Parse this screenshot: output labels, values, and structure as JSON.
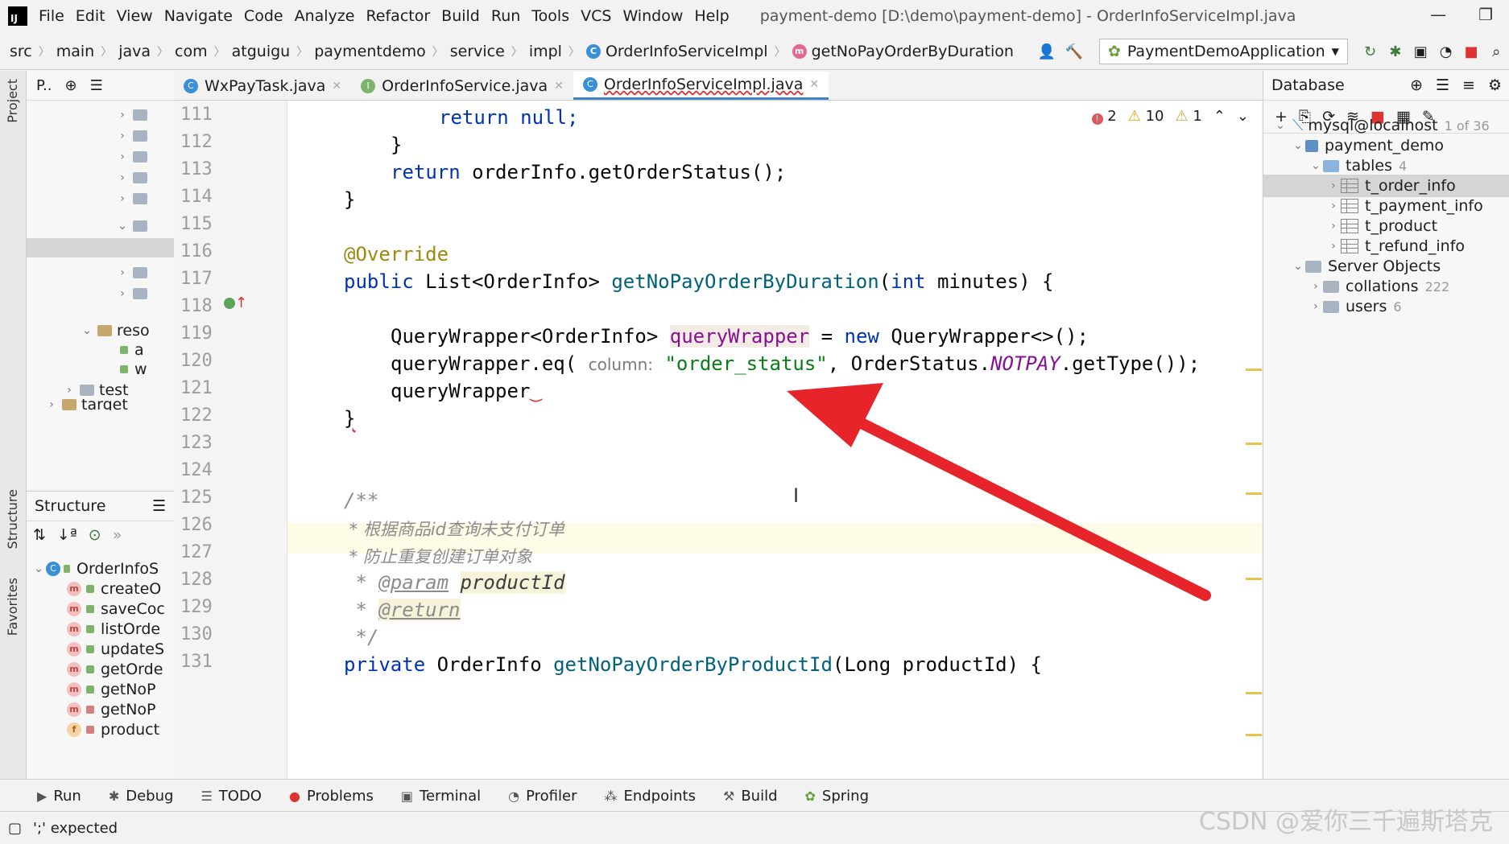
{
  "app": {
    "logo": "IJ",
    "window_title": "payment-demo [D:\\demo\\payment-demo] - OrderInfoServiceImpl.java"
  },
  "menu": [
    "File",
    "Edit",
    "View",
    "Navigate",
    "Code",
    "Analyze",
    "Refactor",
    "Build",
    "Run",
    "Tools",
    "VCS",
    "Window",
    "Help"
  ],
  "breadcrumb": [
    "src",
    "main",
    "java",
    "com",
    "atguigu",
    "paymentdemo",
    "service",
    "impl",
    "OrderInfoServiceImpl",
    "getNoPayOrderByDuration"
  ],
  "run_config": "PaymentDemoApplication",
  "left_strip": {
    "project": "Project",
    "structure": "Structure",
    "favorites": "Favorites"
  },
  "project_panel": {
    "title": "P..",
    "rows": [
      "reso",
      "a",
      "w",
      "test",
      "target"
    ]
  },
  "structure_panel": {
    "title": "Structure",
    "root": "OrderInfoS",
    "items": [
      {
        "kind": "m",
        "label": "createO"
      },
      {
        "kind": "m",
        "label": "saveCoc"
      },
      {
        "kind": "m",
        "label": "listOrde"
      },
      {
        "kind": "m",
        "label": "updateS"
      },
      {
        "kind": "m",
        "label": "getOrde"
      },
      {
        "kind": "m",
        "label": "getNoP"
      },
      {
        "kind": "m",
        "label": "getNoP"
      },
      {
        "kind": "f",
        "label": "product"
      }
    ]
  },
  "tabs": [
    {
      "label": "WxPayTask.java",
      "icon": "C",
      "active": false
    },
    {
      "label": "OrderInfoService.java",
      "icon": "I",
      "active": false
    },
    {
      "label": "OrderInfoServiceImpl.java",
      "icon": "C",
      "active": true
    }
  ],
  "inspections": {
    "errors": "2",
    "warnings": "10",
    "weak": "1"
  },
  "line_numbers": [
    "111",
    "112",
    "113",
    "114",
    "115",
    "116",
    "117",
    "118",
    "119",
    "120",
    "121",
    "122",
    "123",
    "124",
    "125",
    "126",
    "127",
    "128",
    "129",
    "130",
    "131"
  ],
  "code": {
    "l111": "return null;",
    "l112": "}",
    "l113_kw": "return",
    "l113_rest": " orderInfo.getOrderStatus();",
    "l114": "}",
    "l116": "@Override",
    "l117_kw": "public",
    "l117_type": " List<OrderInfo> ",
    "l117_fn": "getNoPayOrderByDuration",
    "l117_rest1": "(",
    "l117_kw2": "int",
    "l117_rest2": " minutes) {",
    "l119_type": "QueryWrapper<OrderInfo> ",
    "l119_var": "queryWrapper",
    "l119_mid": " = ",
    "l119_kw": "new",
    "l119_rest": " QueryWrapper<>();",
    "l120_a": "queryWrapper.eq( ",
    "l120_hint": "column:",
    "l120_str": " \"order_status\"",
    "l120_b": ", OrderStatus.",
    "l120_cst": "NOTPAY",
    "l120_c": ".getType());",
    "l121": "queryWrapper",
    "l122": "}",
    "l125": "/**",
    "l126": " * 根据商品id查询未支付订单",
    "l127": " * 防止重复创建订单对象",
    "l128_a": " * ",
    "l128_tag": "@param",
    "l128_sp": " ",
    "l128_val": "productId",
    "l129_a": " * ",
    "l129_tag": "@return",
    "l130": " */",
    "l131_kw": "private",
    "l131_type": " OrderInfo ",
    "l131_fn": "getNoPayOrderByProductId",
    "l131_rest": "(Long productId) {"
  },
  "database": {
    "title": "Database",
    "rows": [
      {
        "label": "mysql@localhost",
        "count": "1 of 36"
      },
      {
        "label": "payment_demo",
        "count": ""
      },
      {
        "label": "tables",
        "count": "4"
      },
      {
        "label": "t_order_info",
        "count": ""
      },
      {
        "label": "t_payment_info",
        "count": ""
      },
      {
        "label": "t_product",
        "count": ""
      },
      {
        "label": "t_refund_info",
        "count": ""
      },
      {
        "label": "Server Objects",
        "count": ""
      },
      {
        "label": "collations",
        "count": "222"
      },
      {
        "label": "users",
        "count": "6"
      }
    ]
  },
  "bottom_tools": [
    "Run",
    "Debug",
    "TODO",
    "Problems",
    "Terminal",
    "Profiler",
    "Endpoints",
    "Build",
    "Spring"
  ],
  "status": {
    "text": "';' expected"
  },
  "watermark": "CSDN @爱你三千遍斯塔克",
  "colors": {
    "arrow": "#e8242b",
    "accent": "#4083c9"
  }
}
